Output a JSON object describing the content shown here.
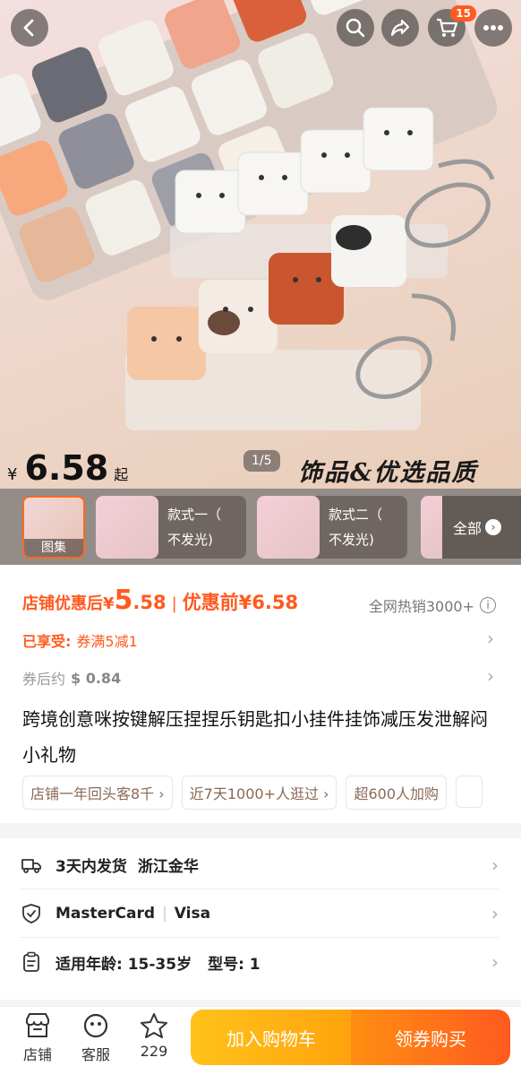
{
  "header": {
    "back_icon": "chevron-left-icon",
    "search_icon": "search-icon",
    "share_icon": "share-icon",
    "cart_icon": "cart-icon",
    "cart_count": "15",
    "more_icon": "more-icon"
  },
  "hero": {
    "currency": "¥",
    "price": "6.58",
    "price_suffix": "起",
    "pager": "1/5",
    "slogan": "饰品&优选品质"
  },
  "thumbnails": {
    "gallery_label": "图集",
    "options": [
      {
        "line1": "款式一（",
        "line2": "不发光)"
      },
      {
        "line1": "款式二（",
        "line2": "不发光)"
      }
    ],
    "all_label": "全部"
  },
  "pricing": {
    "store_discount_label": "店铺优惠后¥",
    "discount_price_int": "5",
    "discount_price_dec": ".58",
    "before_label": "优惠前¥6.58",
    "hot_sales": "全网热销3000+",
    "applied_label": "已享受:",
    "applied_value": "券满5减1",
    "after_coupon_label": "券后约",
    "after_coupon_value": "$ 0.84"
  },
  "product": {
    "title": "跨境创意咪按键解压捏捏乐钥匙扣小挂件挂饰减压发泄解闷小礼物",
    "tags": [
      "店铺一年回头客8千 ›",
      "近7天1000+人逛过 ›",
      "超600人加购",
      ""
    ]
  },
  "service": {
    "shipping": {
      "a": "3天内发货",
      "b": "浙江金华"
    },
    "payment": {
      "a": "MasterCard",
      "b": "Visa"
    },
    "specs": {
      "a": "适用年龄: 15-35岁",
      "b": "型号: 1"
    }
  },
  "bottom_bar": {
    "store_label": "店铺",
    "service_label": "客服",
    "favorite_count": "229",
    "add_to_cart": "加入购物车",
    "buy_with_coupon": "领券购买"
  },
  "colors": {
    "accent": "#ff5a1f",
    "cart_button": "#ffb414",
    "buy_button": "#ff6a17"
  }
}
